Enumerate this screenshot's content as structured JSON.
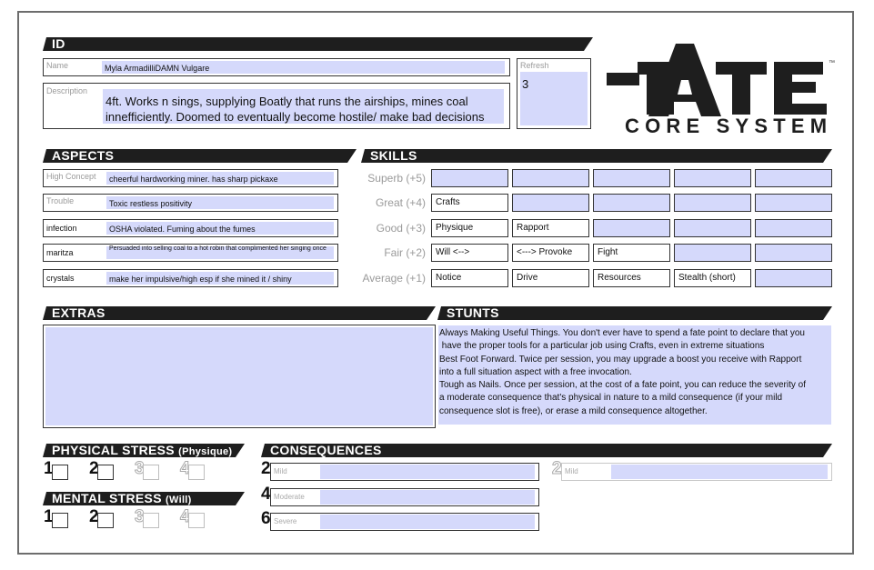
{
  "id": {
    "header": "ID",
    "name_label": "Name",
    "name_value": "Myla ArmadilliDAMN Vulgare",
    "description_label": "Description",
    "description_line1": "4ft. Works n sings, supplying Boatly that runs the airships, mines coal",
    "description_line2": "innefficiently. Doomed to eventually become hostile/ make bad decisions",
    "refresh_label": "Refresh",
    "refresh_value": "3"
  },
  "logo": {
    "title": "FATE",
    "subtitle": "CORE SYSTEM",
    "tm": "™"
  },
  "aspects": {
    "header": "ASPECTS",
    "rows": [
      {
        "label": "High Concept",
        "value": "cheerful hardworking miner. has sharp pickaxe"
      },
      {
        "label": "Trouble",
        "value": "Toxic restless positivity"
      },
      {
        "label": "infection",
        "value": "OSHA violated. Fuming about the fumes"
      },
      {
        "label": "maritza",
        "value": "Persuaded into selling coal to a hot robin that complimented her singing once"
      },
      {
        "label": "crystals",
        "value": "make her impulsive/high esp if she mined it / shiny"
      }
    ]
  },
  "skills": {
    "header": "SKILLS",
    "rows": [
      {
        "label": "Superb (+5)",
        "cells": [
          "",
          "",
          "",
          "",
          ""
        ]
      },
      {
        "label": "Great (+4)",
        "cells": [
          "Crafts",
          "",
          "",
          "",
          ""
        ]
      },
      {
        "label": "Good (+3)",
        "cells": [
          "Physique",
          "Rapport",
          "",
          "",
          ""
        ]
      },
      {
        "label": "Fair (+2)",
        "cells": [
          "Will      <-->",
          "<---> Provoke",
          "Fight",
          "",
          ""
        ]
      },
      {
        "label": "Average (+1)",
        "cells": [
          "Notice",
          "Drive",
          "Resources",
          "Stealth (short)",
          ""
        ]
      }
    ]
  },
  "extras": {
    "header": "EXTRAS"
  },
  "stunts": {
    "header": "STUNTS",
    "lines": [
      "Always Making Useful Things. You don't ever have to spend a fate point to declare that you",
      " have the proper tools for a particular job using Crafts, even in extreme situations",
      "Best Foot Forward. Twice per session, you may upgrade a boost you receive with Rapport",
      "into a full situation aspect with a free invocation.",
      "Tough as Nails. Once per session, at the cost of a fate point, you can reduce the severity of",
      "a moderate consequence that's physical in nature to a mild consequence (if your mild",
      "consequence slot is free), or erase a mild consequence altogether."
    ]
  },
  "physical_stress": {
    "header": "PHYSICAL STRESS",
    "sub": "(Physique)",
    "boxes": [
      "1",
      "2",
      "3",
      "4"
    ]
  },
  "mental_stress": {
    "header": "MENTAL STRESS",
    "sub": "(Will)",
    "boxes": [
      "1",
      "2",
      "3",
      "4"
    ]
  },
  "consequences": {
    "header": "CONSEQUENCES",
    "slots": [
      {
        "num": "2",
        "label": "Mild"
      },
      {
        "num": "2",
        "label": "Mild"
      },
      {
        "num": "4",
        "label": "Moderate"
      },
      {
        "num": "6",
        "label": "Severe"
      }
    ]
  }
}
